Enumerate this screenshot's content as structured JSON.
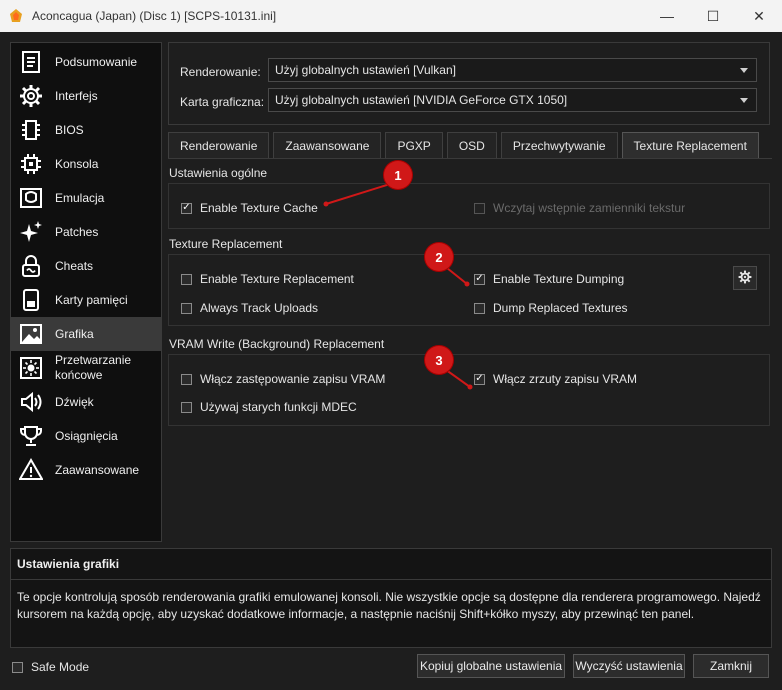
{
  "window": {
    "title": "Aconcagua (Japan) (Disc 1) [SCPS-10131.ini]",
    "minimize": "—",
    "maximize": "☐",
    "close": "✕"
  },
  "sidebar": {
    "items": [
      {
        "label": "Podsumowanie",
        "icon": "summary-icon"
      },
      {
        "label": "Interfejs",
        "icon": "gear-icon"
      },
      {
        "label": "BIOS",
        "icon": "chip-icon"
      },
      {
        "label": "Konsola",
        "icon": "cpu-icon"
      },
      {
        "label": "Emulacja",
        "icon": "emulation-icon"
      },
      {
        "label": "Patches",
        "icon": "sparkle-icon"
      },
      {
        "label": "Cheats",
        "icon": "lock-icon"
      },
      {
        "label": "Karty pamięci",
        "icon": "memory-card-icon"
      },
      {
        "label": "Grafika",
        "icon": "image-icon"
      },
      {
        "label": "Przetwarzanie końcowe",
        "icon": "brightness-icon"
      },
      {
        "label": "Dźwięk",
        "icon": "speaker-icon"
      },
      {
        "label": "Osiągnięcia",
        "icon": "trophy-icon"
      },
      {
        "label": "Zaawansowane",
        "icon": "warning-icon"
      }
    ],
    "active": "Grafika"
  },
  "top": {
    "renderer_label": "Renderowanie:",
    "renderer_value": "Użyj globalnych ustawień [Vulkan]",
    "adapter_label": "Karta graficzna:",
    "adapter_value": "Użyj globalnych ustawień [NVIDIA GeForce GTX 1050]"
  },
  "tabs": [
    {
      "label": "Renderowanie"
    },
    {
      "label": "Zaawansowane"
    },
    {
      "label": "PGXP"
    },
    {
      "label": "OSD"
    },
    {
      "label": "Przechwytywanie"
    },
    {
      "label": "Texture Replacement"
    }
  ],
  "active_tab": "Texture Replacement",
  "general": {
    "title": "Ustawienia ogólne",
    "enable_cache": {
      "label": "Enable Texture Cache",
      "checked": true
    },
    "preload": {
      "label": "Wczytaj wstępnie zamienniki tekstur",
      "checked": false,
      "disabled": true
    }
  },
  "texture": {
    "title": "Texture Replacement",
    "enable_replacement": {
      "label": "Enable Texture Replacement",
      "checked": false
    },
    "enable_dumping": {
      "label": "Enable Texture Dumping",
      "checked": true
    },
    "track_uploads": {
      "label": "Always Track Uploads",
      "checked": false
    },
    "dump_replaced": {
      "label": "Dump Replaced Textures",
      "checked": false
    }
  },
  "vram": {
    "title": "VRAM Write (Background) Replacement",
    "enable_vram_replacement": {
      "label": "Włącz zastępowanie zapisu VRAM",
      "checked": false
    },
    "enable_vram_dump": {
      "label": "Włącz zrzuty zapisu VRAM",
      "checked": true
    },
    "old_mdec": {
      "label": "Używaj starych funkcji MDEC",
      "checked": false
    }
  },
  "markers": [
    "1",
    "2",
    "3"
  ],
  "marker_color": "#d01818",
  "description": {
    "title": "Ustawienia grafiki",
    "text": "Te opcje kontrolują sposób renderowania grafiki emulowanej konsoli. Nie wszystkie opcje są dostępne dla renderera programowego. Najedź kursorem na każdą opcję, aby uzyskać dodatkowe informacje, a następnie naciśnij Shift+kółko myszy, aby przewinąć ten panel."
  },
  "footer": {
    "safe_mode": {
      "label": "Safe Mode",
      "checked": false
    },
    "copy_global": "Kopiuj globalne ustawienia",
    "clear": "Wyczyść ustawienia",
    "close": "Zamknij"
  }
}
